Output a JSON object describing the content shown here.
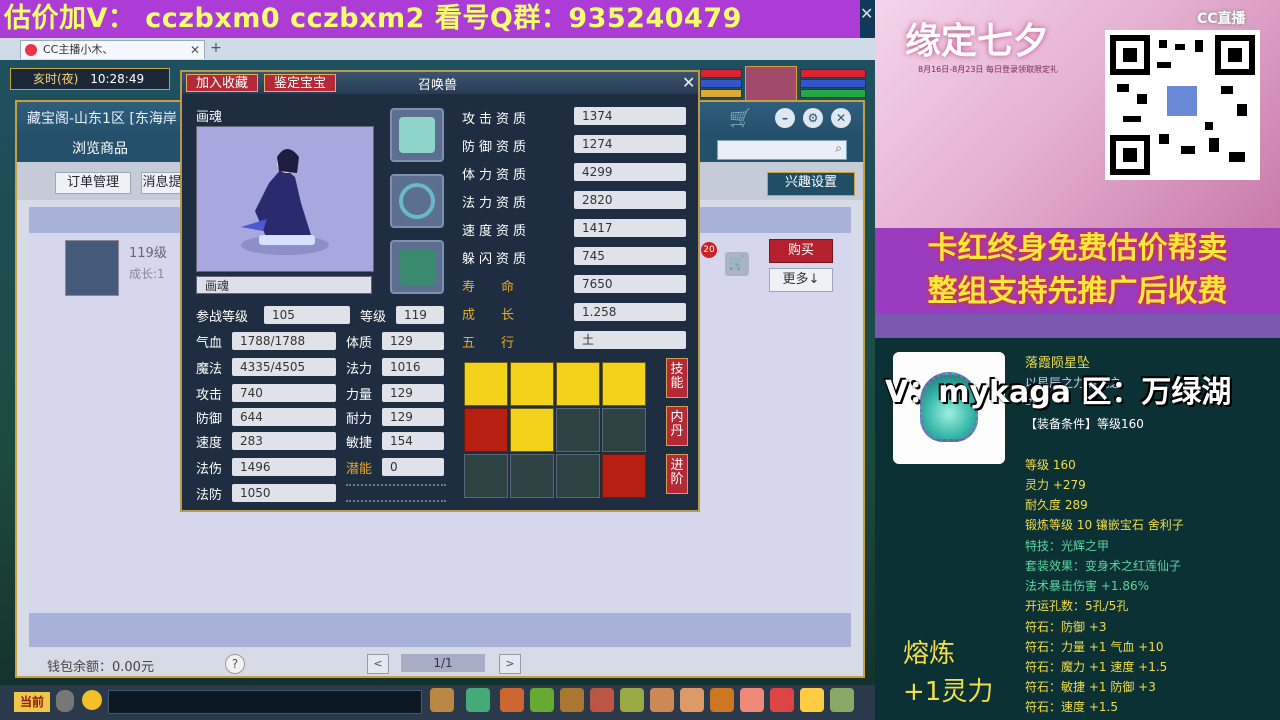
{
  "banner": {
    "text": "估价加V：  cczbxm0   cczbxm2   看号Q群：935240479"
  },
  "browser_tab": {
    "title": "CC主播小木、"
  },
  "status": {
    "time_label": "亥时(夜)",
    "time": "10:28:49"
  },
  "shop": {
    "title": "藏宝阁-山东1区 [东海岸",
    "nav_browse": "浏览商品",
    "btn_orders": "订单管理",
    "btn_messages": "消息提",
    "btn_interest": "兴趣设置",
    "item_level": "119级",
    "item_growth": "成长:1",
    "buy": "购买",
    "more": "更多↓",
    "cart_count": "20",
    "wallet": "钱包余额：0.00元",
    "help": "?",
    "prev": "<",
    "next": ">",
    "page": "1/1"
  },
  "pet": {
    "title": "召唤兽",
    "btn_favorite": "加入收藏",
    "btn_appraise": "鉴定宝宝",
    "close": "✕",
    "name_label": "画魂",
    "name_value": "画魂",
    "stats_left": [
      {
        "label": "参战等级",
        "value": "105"
      },
      {
        "label": "气血",
        "value": "1788/1788"
      },
      {
        "label": "魔法",
        "value": "4335/4505"
      },
      {
        "label": "攻击",
        "value": "740"
      },
      {
        "label": "防御",
        "value": "644"
      },
      {
        "label": "速度",
        "value": "283"
      },
      {
        "label": "法伤",
        "value": "1496"
      },
      {
        "label": "法防",
        "value": "1050"
      }
    ],
    "stats_right": [
      {
        "label": "等级",
        "value": "119"
      },
      {
        "label": "体质",
        "value": "129"
      },
      {
        "label": "法力",
        "value": "1016"
      },
      {
        "label": "力量",
        "value": "129"
      },
      {
        "label": "耐力",
        "value": "129"
      },
      {
        "label": "敏捷",
        "value": "154"
      },
      {
        "label": "潜能",
        "value": "0"
      }
    ],
    "qualities": [
      {
        "label": "攻击资质",
        "value": "1374"
      },
      {
        "label": "防御资质",
        "value": "1274"
      },
      {
        "label": "体力资质",
        "value": "4299"
      },
      {
        "label": "法力资质",
        "value": "2820"
      },
      {
        "label": "速度资质",
        "value": "1417"
      },
      {
        "label": "躲闪资质",
        "value": "745"
      }
    ],
    "lifespan_label": "寿　　命",
    "lifespan": "7650",
    "growth_label": "成　　长",
    "growth": "1.258",
    "element_label": "五　　行",
    "element": "土",
    "side_skill": "技能",
    "side_dan": "内丹",
    "side_advance": "进阶"
  },
  "overlay": {
    "qixi_title": "缘定七夕",
    "qixi_sub": "8月16日-8月23日 每日登录领取限定礼",
    "cc_logo": "CC直播",
    "promo_line1": "卡红终身免费估价帮卖",
    "promo_line2": "整组支持先推广后收费",
    "vx": "V：mykaga  区：万绿湖",
    "item_name": "落霞陨星坠",
    "item_desc": "以星辰之力铸就之玉。",
    "item_cond": "【装备条件】等级160",
    "item_lines": [
      "等级 160",
      "灵力 +279",
      "耐久度 289",
      "锻炼等级 10  镶嵌宝石 舍利子",
      "特技：光辉之甲",
      "套装效果：变身术之红莲仙子",
      "法术暴击伤害 +1.86%",
      "开运孔数：5孔/5孔",
      "符石：防御 +3",
      "符石：力量 +1  气血 +10",
      "符石：魔力 +1  速度 +1.5",
      "符石：敏捷 +1  防御 +3",
      "符石：速度 +1.5"
    ],
    "smelt_title": "熔炼",
    "smelt_value": "+1灵力"
  },
  "taskbar": {
    "current": "当前"
  },
  "colors": {
    "banner_bg": "#ad3bd6",
    "banner_text": "#f5ff6e",
    "gold": "#e7a92a",
    "promo_text": "#f8e83e"
  }
}
